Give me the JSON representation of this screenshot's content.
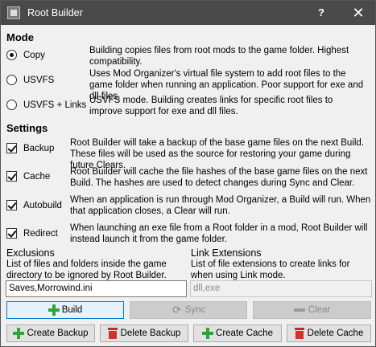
{
  "window": {
    "title": "Root Builder",
    "help": "?",
    "close": "✕"
  },
  "mode": {
    "header": "Mode",
    "options": [
      {
        "label": "Copy",
        "selected": true,
        "desc": "Building copies files from root mods to the game folder. Highest compatibility."
      },
      {
        "label": "USVFS",
        "selected": false,
        "desc": "Uses Mod Organizer's virtual file system to add root files to the game folder when running an application. Poor support for exe and dll files."
      },
      {
        "label": "USVFS + Links",
        "selected": false,
        "desc": "USVFS mode. Building creates links for specific root files to improve support for exe and dll files."
      }
    ]
  },
  "settings": {
    "header": "Settings",
    "options": [
      {
        "label": "Backup",
        "checked": true,
        "desc": "Root Builder will take a backup of the base game files on the next Build. These files will be used as the source for restoring your game during future Clears."
      },
      {
        "label": "Cache",
        "checked": true,
        "desc": "Root Builder will cache the file hashes of the base game files on the next Build. The hashes are used to detect changes during Sync and Clear."
      },
      {
        "label": "Autobuild",
        "checked": true,
        "desc": "When an application is run through Mod Organizer, a Build will run. When that application closes, a Clear will run."
      },
      {
        "label": "Redirect",
        "checked": true,
        "desc": "When launching an exe file from a Root folder in a mod, Root Builder will instead launch it from the game folder."
      }
    ]
  },
  "exclusions": {
    "header": "Exclusions",
    "desc": "List of files and folders inside the game directory to be ignored by Root Builder.",
    "value": "Saves,Morrowind.ini"
  },
  "link_extensions": {
    "header": "Link Extensions",
    "desc": "List of file extensions to create links for when using Link mode.",
    "value": "dll,exe"
  },
  "actions": {
    "build": "Build",
    "sync": "Sync",
    "clear": "Clear",
    "create_backup": "Create Backup",
    "delete_backup": "Delete Backup",
    "create_cache": "Create Cache",
    "delete_cache": "Delete Cache"
  },
  "colors": {
    "titlebar": "#4a4a4a",
    "accent": "#0078d7",
    "green": "#2ea43a",
    "red": "#d32f2f"
  }
}
